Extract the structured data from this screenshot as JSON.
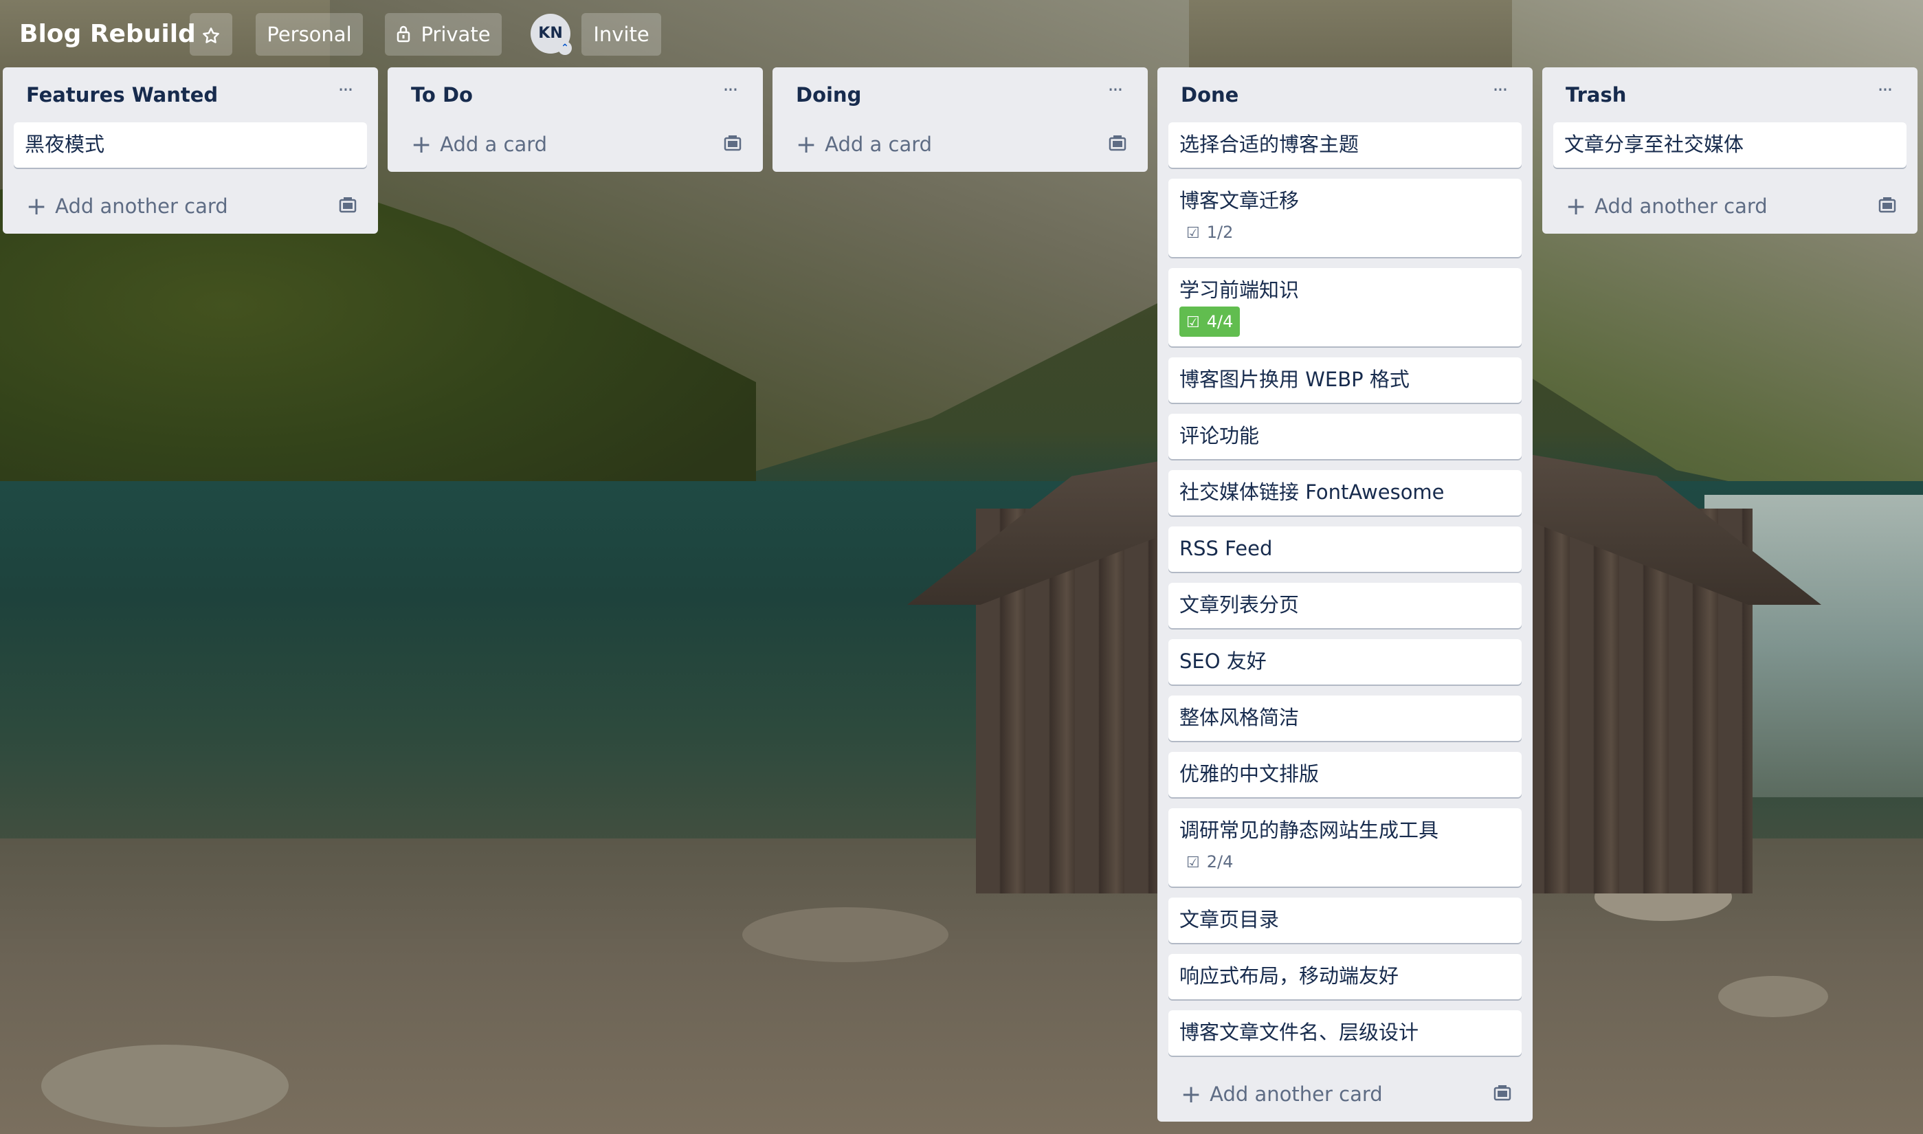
{
  "board": {
    "title": "Blog Rebuild",
    "star_icon": "star-icon",
    "workspace_label": "Personal",
    "visibility_label": "Private",
    "visibility_icon": "lock-icon",
    "member_initials": "KN",
    "invite_label": "Invite"
  },
  "colors": {
    "list_bg": "#ebecf0",
    "card_bg": "#ffffff",
    "text": "#172b4d",
    "muted": "#5e6c84",
    "checklist_complete": "#61bd4f"
  },
  "lists": [
    {
      "title": "Features Wanted",
      "cards": [
        {
          "title": "黑夜模式"
        }
      ],
      "add_label": "Add another card"
    },
    {
      "title": "To Do",
      "cards": [],
      "add_label": "Add a card"
    },
    {
      "title": "Doing",
      "cards": [],
      "add_label": "Add a card"
    },
    {
      "title": "Done",
      "cards": [
        {
          "title": "选择合适的博客主题"
        },
        {
          "title": "博客文章迁移",
          "checklist": "1/2",
          "checklist_complete": false
        },
        {
          "title": "学习前端知识",
          "checklist": "4/4",
          "checklist_complete": true
        },
        {
          "title": "博客图片换用 WEBP 格式"
        },
        {
          "title": "评论功能"
        },
        {
          "title": "社交媒体链接 FontAwesome"
        },
        {
          "title": "RSS Feed"
        },
        {
          "title": "文章列表分页"
        },
        {
          "title": "SEO 友好"
        },
        {
          "title": "整体风格简洁"
        },
        {
          "title": "优雅的中文排版"
        },
        {
          "title": "调研常见的静态网站生成工具",
          "checklist": "2/4",
          "checklist_complete": false
        },
        {
          "title": "文章页目录"
        },
        {
          "title": "响应式布局，移动端友好"
        },
        {
          "title": "博客文章文件名、层级设计"
        }
      ],
      "add_label": "Add another card"
    },
    {
      "title": "Trash",
      "cards": [
        {
          "title": "文章分享至社交媒体"
        }
      ],
      "add_label": "Add another card"
    }
  ]
}
